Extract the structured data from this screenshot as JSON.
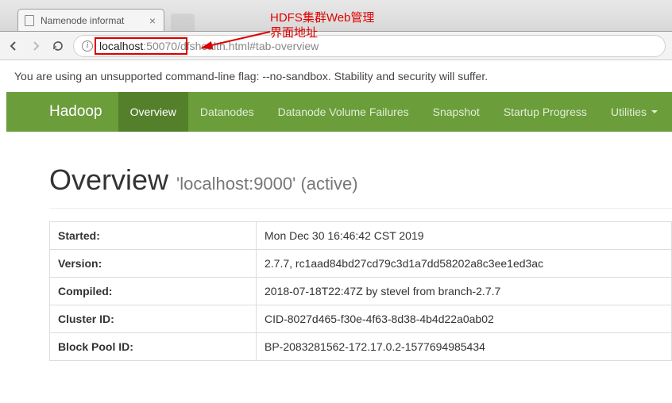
{
  "browser": {
    "tab_title": "Namenode informat",
    "url_host": "localhost",
    "url_port": ":50070",
    "url_path": "/dfshealth.html#tab-overview",
    "warning": "You are using an unsupported command-line flag: --no-sandbox. Stability and security will suffer."
  },
  "annotation": {
    "line1": "HDFS集群Web管理",
    "line2": "界面地址"
  },
  "navbar": {
    "brand": "Hadoop",
    "items": [
      "Overview",
      "Datanodes",
      "Datanode Volume Failures",
      "Snapshot",
      "Startup Progress",
      "Utilities"
    ],
    "active_index": 0,
    "dropdown_index": 5
  },
  "heading": {
    "title": "Overview",
    "subtitle": "'localhost:9000' (active)"
  },
  "table": [
    {
      "label": "Started:",
      "value": "Mon Dec 30 16:46:42 CST 2019"
    },
    {
      "label": "Version:",
      "value": "2.7.7, rc1aad84bd27cd79c3d1a7dd58202a8c3ee1ed3ac"
    },
    {
      "label": "Compiled:",
      "value": "2018-07-18T22:47Z by stevel from branch-2.7.7"
    },
    {
      "label": "Cluster ID:",
      "value": "CID-8027d465-f30e-4f63-8d38-4b4d22a0ab02"
    },
    {
      "label": "Block Pool ID:",
      "value": "BP-2083281562-172.17.0.2-1577694985434"
    }
  ]
}
